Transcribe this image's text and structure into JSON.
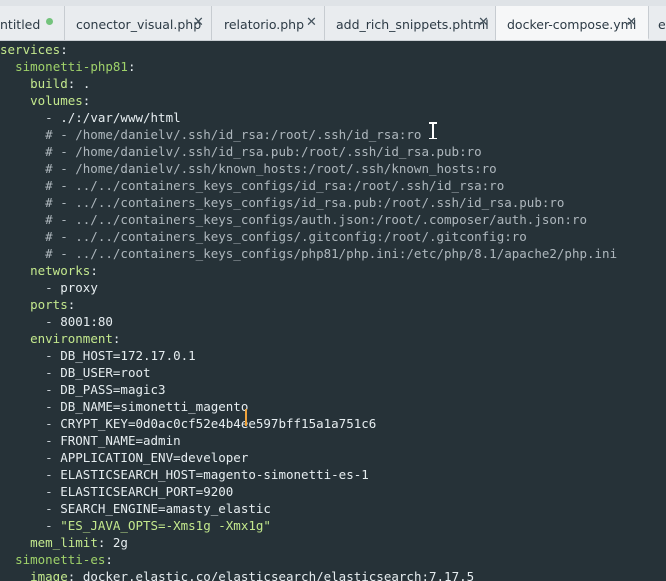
{
  "tabs": [
    {
      "label": "ntitled",
      "modified": true
    },
    {
      "label": "conector_visual.php"
    },
    {
      "label": "relatorio.php"
    },
    {
      "label": "add_rich_snippets.phtml"
    },
    {
      "label": "docker-compose.yml",
      "active": true
    },
    {
      "label": "e"
    }
  ],
  "close_glyph": "✕",
  "code": [
    {
      "indent": "",
      "key": "services",
      "after": ":"
    },
    {
      "indent": "  ",
      "key": "simonetti-php81",
      "after": ":"
    },
    {
      "indent": "    ",
      "key": "build",
      "after": ": ",
      "value": "."
    },
    {
      "indent": "    ",
      "key": "volumes",
      "after": ":"
    },
    {
      "indent": "      ",
      "dash": "- ",
      "value": "./:/var/www/html"
    },
    {
      "indent": "      ",
      "comment": "# - /home/danielv/.ssh/id_rsa:/root/.ssh/id_rsa:ro"
    },
    {
      "indent": "      ",
      "comment": "# - /home/danielv/.ssh/id_rsa.pub:/root/.ssh/id_rsa.pub:ro"
    },
    {
      "indent": "      ",
      "comment": "# - /home/danielv/.ssh/known_hosts:/root/.ssh/known_hosts:ro"
    },
    {
      "indent": "      ",
      "comment": "# - ../../containers_keys_configs/id_rsa:/root/.ssh/id_rsa:ro"
    },
    {
      "indent": "      ",
      "comment": "# - ../../containers_keys_configs/id_rsa.pub:/root/.ssh/id_rsa.pub:ro"
    },
    {
      "indent": "      ",
      "comment": "# - ../../containers_keys_configs/auth.json:/root/.composer/auth.json:ro"
    },
    {
      "indent": "      ",
      "comment": "# - ../../containers_keys_configs/.gitconfig:/root/.gitconfig:ro"
    },
    {
      "indent": "      ",
      "comment": "# - ../../containers_keys_configs/php81/php.ini:/etc/php/8.1/apache2/php.ini"
    },
    {
      "indent": "    ",
      "key": "networks",
      "after": ":"
    },
    {
      "indent": "      ",
      "dash": "- ",
      "value": "proxy"
    },
    {
      "indent": "    ",
      "key": "ports",
      "after": ":"
    },
    {
      "indent": "      ",
      "dash": "- ",
      "value": "8001:80"
    },
    {
      "indent": "    ",
      "key": "environment",
      "after": ":"
    },
    {
      "indent": "      ",
      "dash": "- ",
      "value": "DB_HOST=172.17.0.1"
    },
    {
      "indent": "      ",
      "dash": "- ",
      "value": "DB_USER=root"
    },
    {
      "indent": "      ",
      "dash": "- ",
      "value": "DB_PASS=magic3"
    },
    {
      "indent": "      ",
      "dash": "- ",
      "value": "DB_NAME=simonetti_magento"
    },
    {
      "indent": "      ",
      "dash": "- ",
      "value": "CRYPT_KEY=0d0ac0cf52e4b4ee597bff15a1a751c6"
    },
    {
      "indent": "      ",
      "dash": "- ",
      "value": "FRONT_NAME=admin"
    },
    {
      "indent": "      ",
      "dash": "- ",
      "value": "APPLICATION_ENV=developer"
    },
    {
      "indent": "      ",
      "dash": "- ",
      "value": "ELASTICSEARCH_HOST=magento-simonetti-es-1"
    },
    {
      "indent": "      ",
      "dash": "- ",
      "value": "ELASTICSEARCH_PORT=9200"
    },
    {
      "indent": "      ",
      "dash": "- ",
      "value": "SEARCH_ENGINE=amasty_elastic"
    },
    {
      "indent": "      ",
      "dash": "- ",
      "string": "\"ES_JAVA_OPTS=-Xms1g -Xmx1g\""
    },
    {
      "indent": "    ",
      "key": "mem_limit",
      "after": ": ",
      "value": "2g"
    },
    {
      "indent": "  ",
      "key": "simonetti-es",
      "after": ":"
    },
    {
      "indent": "    ",
      "key": "image",
      "after": ": ",
      "value": "docker.elastic.co/elasticsearch/elasticsearch:7.17.5"
    }
  ],
  "colors": {
    "editor_bg": "#263238",
    "key_color": "#c3e88d",
    "comment_color": "#aeb7bd",
    "cursor_color": "#f0a33c",
    "tab_bar_bg": "#e9ecef",
    "modified_dot": "#73c37c"
  }
}
